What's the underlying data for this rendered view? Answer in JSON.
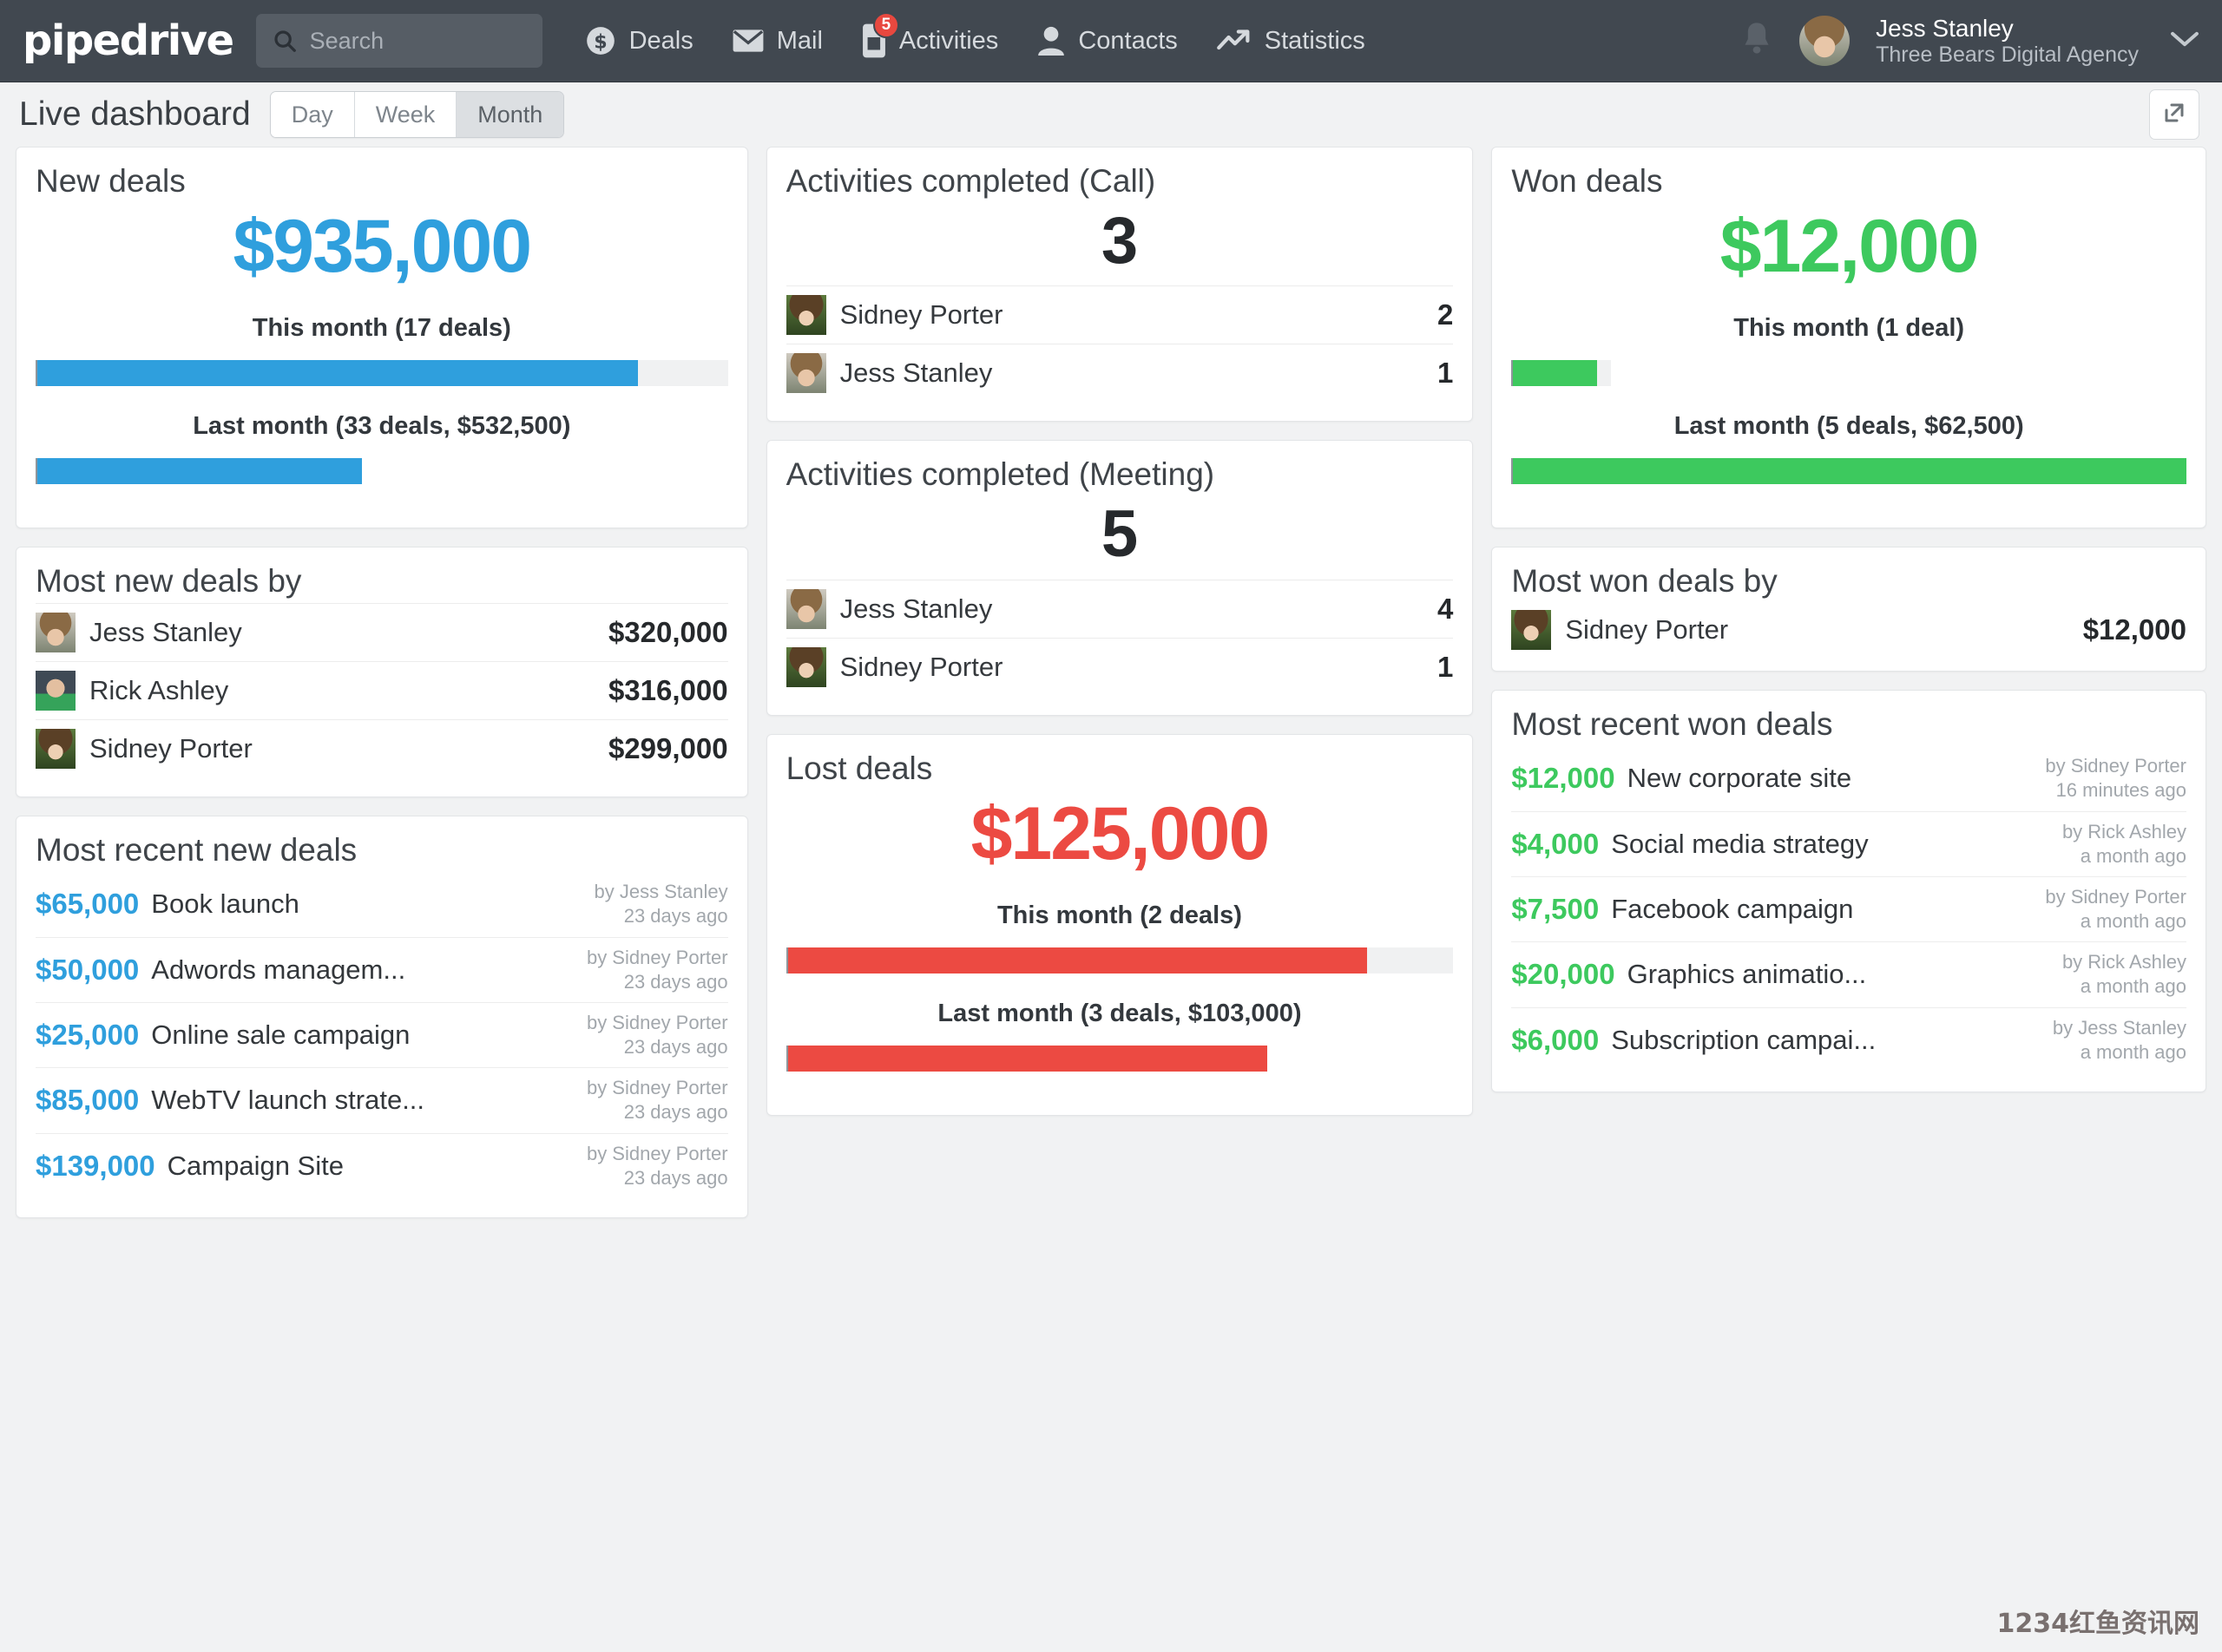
{
  "header": {
    "logo": "pipedrive",
    "search": {
      "placeholder": "Search",
      "value": "",
      "icon": "search-icon"
    },
    "nav": [
      {
        "label": "Deals",
        "icon": "dollar-coin-icon",
        "badge": ""
      },
      {
        "label": "Mail",
        "icon": "envelope-icon",
        "badge": ""
      },
      {
        "label": "Activities",
        "icon": "phone-icon",
        "badge": "5"
      },
      {
        "label": "Contacts",
        "icon": "person-icon",
        "badge": ""
      },
      {
        "label": "Statistics",
        "icon": "trend-arrow-icon",
        "badge": ""
      }
    ],
    "notifications_icon": "bell-icon",
    "user": {
      "name": "Jess Stanley",
      "company": "Three Bears Digital Agency",
      "avatar": "user-avatar",
      "chevron": "chevron-down-icon"
    }
  },
  "subheader": {
    "title": "Live dashboard",
    "period_options": [
      "Day",
      "Week",
      "Month"
    ],
    "period_selected": "Month",
    "expand_icon": "expand-external-icon"
  },
  "colors": {
    "blue": "#2f9fdd",
    "green": "#3dc95e",
    "red": "#ec4a42",
    "header_bg": "#414850",
    "page_bg": "#f1f2f3"
  },
  "cards": {
    "new_deals": {
      "title": "New deals",
      "value": "$935,000",
      "this_month_label": "This month (17 deals)",
      "last_month_label": "Last month (33 deals, $532,500)",
      "this_month_pct": 87,
      "this_month_track_pct": 100,
      "last_month_pct": 47
    },
    "activities_call": {
      "title": "Activities completed (Call)",
      "count": "3",
      "rows": [
        {
          "name": "Sidney Porter",
          "value": "2",
          "avatar": "sidney-avatar"
        },
        {
          "name": "Jess Stanley",
          "value": "1",
          "avatar": "jess-avatar"
        }
      ]
    },
    "activities_meeting": {
      "title": "Activities completed (Meeting)",
      "count": "5",
      "rows": [
        {
          "name": "Jess Stanley",
          "value": "4",
          "avatar": "jess-avatar"
        },
        {
          "name": "Sidney Porter",
          "value": "1",
          "avatar": "sidney-avatar"
        }
      ]
    },
    "won_deals": {
      "title": "Won deals",
      "value": "$12,000",
      "this_month_label": "This month (1 deal)",
      "last_month_label": "Last month (5 deals, $62,500)",
      "this_month_pct": 12.5,
      "this_month_track_pct": 14.5,
      "last_month_pct": 100
    },
    "most_new_deals_by": {
      "title": "Most new deals by",
      "rows": [
        {
          "name": "Jess Stanley",
          "value": "$320,000",
          "avatar": "jess-avatar"
        },
        {
          "name": "Rick Ashley",
          "value": "$316,000",
          "avatar": "rick-avatar"
        },
        {
          "name": "Sidney Porter",
          "value": "$299,000",
          "avatar": "sidney-avatar"
        }
      ]
    },
    "lost_deals": {
      "title": "Lost deals",
      "value": "$125,000",
      "this_month_label": "This month (2 deals)",
      "last_month_label": "Last month (3 deals, $103,000)",
      "this_month_pct": 87,
      "this_month_track_pct": 100,
      "last_month_pct": 72
    },
    "most_won_deals_by": {
      "title": "Most won deals by",
      "rows": [
        {
          "name": "Sidney Porter",
          "value": "$12,000",
          "avatar": "sidney-avatar"
        }
      ]
    },
    "most_recent_new_deals": {
      "title": "Most recent new deals",
      "rows": [
        {
          "amount": "$65,000",
          "name": "Book launch",
          "by": "by Jess Stanley",
          "time": "23 days ago"
        },
        {
          "amount": "$50,000",
          "name": "Adwords managem...",
          "by": "by Sidney Porter",
          "time": "23 days ago"
        },
        {
          "amount": "$25,000",
          "name": "Online sale campaign",
          "by": "by Sidney Porter",
          "time": "23 days ago"
        },
        {
          "amount": "$85,000",
          "name": "WebTV launch strate...",
          "by": "by Sidney Porter",
          "time": "23 days ago"
        },
        {
          "amount": "$139,000",
          "name": "Campaign Site",
          "by": "by Sidney Porter",
          "time": "23 days ago"
        }
      ]
    },
    "most_recent_won_deals": {
      "title": "Most recent won deals",
      "rows": [
        {
          "amount": "$12,000",
          "name": "New corporate site",
          "by": "by Sidney Porter",
          "time": "16 minutes ago"
        },
        {
          "amount": "$4,000",
          "name": "Social media strategy",
          "by": "by Rick Ashley",
          "time": "a month ago"
        },
        {
          "amount": "$7,500",
          "name": "Facebook campaign",
          "by": "by Sidney Porter",
          "time": "a month ago"
        },
        {
          "amount": "$20,000",
          "name": "Graphics animatio...",
          "by": "by Rick Ashley",
          "time": "a month ago"
        },
        {
          "amount": "$6,000",
          "name": "Subscription campai...",
          "by": "by Jess Stanley",
          "time": "a month ago"
        }
      ]
    }
  },
  "watermark": "1234红鱼资讯网"
}
